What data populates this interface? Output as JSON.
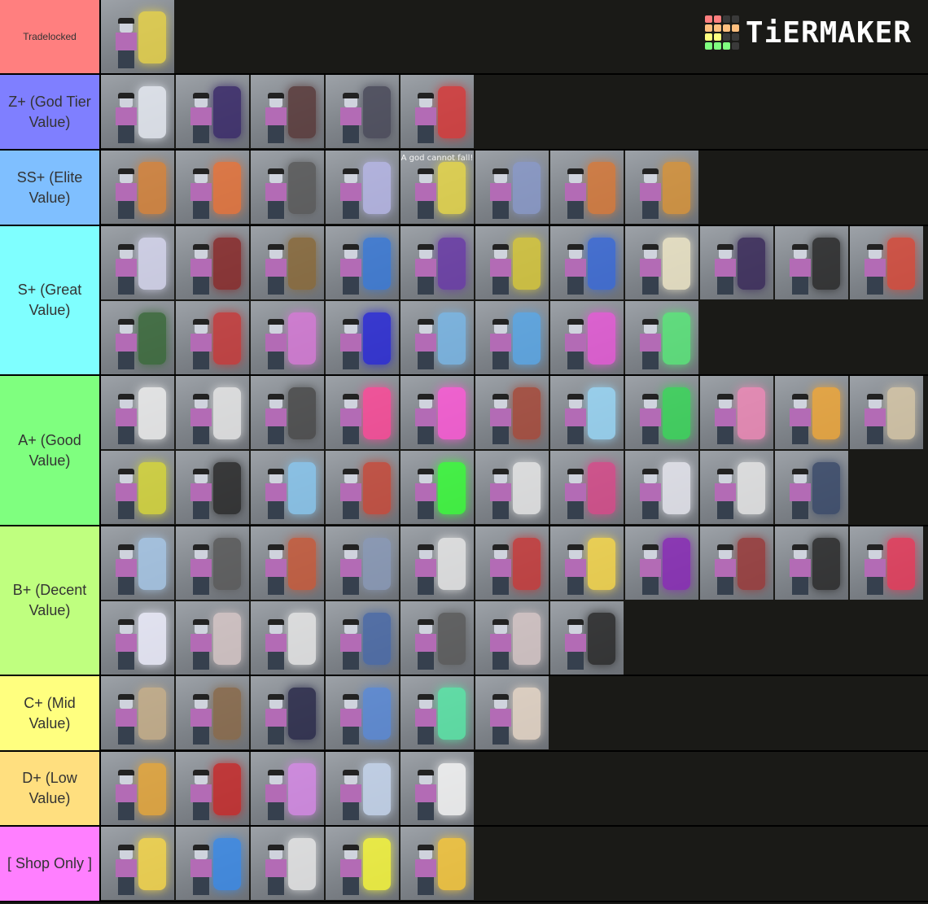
{
  "logo": {
    "text": "TiERMAKER",
    "grid_colors": [
      "#ff7f7f",
      "#ff7f7f",
      "#3a3a3a",
      "#3a3a3a",
      "#ffbf7f",
      "#ffbf7f",
      "#ffbf7f",
      "#ffbf7f",
      "#ffff7f",
      "#ffff7f",
      "#3a3a3a",
      "#3a3a3a",
      "#7fff7f",
      "#7fff7f",
      "#7fff7f",
      "#3a3a3a"
    ]
  },
  "tiers": [
    {
      "label": "Tradelocked",
      "color": "#ff7f7f",
      "small": true,
      "height": 92,
      "items": [
        {
          "stand": "#e8d34a"
        }
      ]
    },
    {
      "label": "Z+ (God Tier Value)",
      "color": "#7f7fff",
      "height": 93,
      "items": [
        {
          "stand": "#e8ecf4"
        },
        {
          "stand": "#3a2a6a"
        },
        {
          "stand": "#5a3a3a"
        },
        {
          "stand": "#4a4a5a"
        },
        {
          "stand": "#d83a3a"
        }
      ]
    },
    {
      "label": "SS+ (Elite Value)",
      "color": "#7fbfff",
      "height": 93,
      "items": [
        {
          "stand": "#d8843a"
        },
        {
          "stand": "#e8743a"
        },
        {
          "stand": "#5a5a5a"
        },
        {
          "stand": "#b8b8e8"
        },
        {
          "stand": "#e8d84a",
          "caption": "A god cannot fall!"
        },
        {
          "stand": "#8a9aca"
        },
        {
          "stand": "#d87a3a"
        },
        {
          "stand": "#d8943a"
        }
      ]
    },
    {
      "label": "S+ (Great Value)",
      "color": "#7fffff",
      "height": 184,
      "items": [
        {
          "stand": "#d8d8f0"
        },
        {
          "stand": "#8a2a2a"
        },
        {
          "stand": "#8a6a3a"
        },
        {
          "stand": "#3a7ad8"
        },
        {
          "stand": "#6a3aa8"
        },
        {
          "stand": "#d8c83a"
        },
        {
          "stand": "#3a6ad8"
        },
        {
          "stand": "#f0e8c8"
        },
        {
          "stand": "#3a2a5a"
        },
        {
          "stand": "#2a2a2a"
        },
        {
          "stand": "#d84a3a"
        },
        {
          "stand": "#3a6a3a"
        },
        {
          "stand": "#c83a3a"
        },
        {
          "stand": "#d87ad8"
        },
        {
          "stand": "#2a2ad8"
        },
        {
          "stand": "#7ab8e8"
        },
        {
          "stand": "#5aa8e8"
        },
        {
          "stand": "#e85ad8"
        },
        {
          "stand": "#5ae87a"
        }
      ]
    },
    {
      "label": "A+ (Good Value)",
      "color": "#7fff7f",
      "height": 185,
      "items": [
        {
          "stand": "#f0f0f0"
        },
        {
          "stand": "#e8e8e8"
        },
        {
          "stand": "#4a4a4a"
        },
        {
          "stand": "#ff4a9a"
        },
        {
          "stand": "#ff5ad8"
        },
        {
          "stand": "#a84a3a"
        },
        {
          "stand": "#9ad8f8"
        },
        {
          "stand": "#3ad85a"
        },
        {
          "stand": "#f08ab8"
        },
        {
          "stand": "#f0a83a"
        },
        {
          "stand": "#d8c8a8"
        },
        {
          "stand": "#d8d83a"
        },
        {
          "stand": "#2a2a2a"
        },
        {
          "stand": "#8ac8f0"
        },
        {
          "stand": "#c84a3a"
        },
        {
          "stand": "#3aff3a"
        },
        {
          "stand": "#e8e8e8"
        },
        {
          "stand": "#d84a8a"
        },
        {
          "stand": "#e8e8f0"
        },
        {
          "stand": "#e8e8e8"
        },
        {
          "stand": "#3a4a6a"
        }
      ]
    },
    {
      "label": "B+ (Decent Value)",
      "color": "#bfff7f",
      "height": 184,
      "items": [
        {
          "stand": "#a8c8e8"
        },
        {
          "stand": "#5a5a5a"
        },
        {
          "stand": "#c85a3a"
        },
        {
          "stand": "#8a9ab8"
        },
        {
          "stand": "#e8e8e8"
        },
        {
          "stand": "#c83a3a"
        },
        {
          "stand": "#f8d84a"
        },
        {
          "stand": "#8a2ab8"
        },
        {
          "stand": "#9a3a3a"
        },
        {
          "stand": "#2a2a2a"
        },
        {
          "stand": "#e83a5a"
        },
        {
          "stand": "#f0f0ff"
        },
        {
          "stand": "#d8c8c8"
        },
        {
          "stand": "#e8e8e8"
        },
        {
          "stand": "#4a6aa8"
        },
        {
          "stand": "#5a5a5a"
        },
        {
          "stand": "#d8c8c8"
        },
        {
          "stand": "#2a2a2a"
        }
      ]
    },
    {
      "label": "C+ (Mid Value)",
      "color": "#ffff7f",
      "height": 93,
      "items": [
        {
          "stand": "#c8b08a"
        },
        {
          "stand": "#8a6a4a"
        },
        {
          "stand": "#2a2a4a"
        },
        {
          "stand": "#5a8ad8"
        },
        {
          "stand": "#5ae8a8"
        },
        {
          "stand": "#e8d8c8"
        }
      ]
    },
    {
      "label": "D+ (Low Value)",
      "color": "#ffdf7f",
      "height": 92,
      "items": [
        {
          "stand": "#e8a83a"
        },
        {
          "stand": "#c82a2a"
        },
        {
          "stand": "#d88ae8"
        },
        {
          "stand": "#c8d8f0"
        },
        {
          "stand": "#f8f8f8"
        }
      ]
    },
    {
      "label": "[ Shop Only ]",
      "color": "#ff7fff",
      "height": 93,
      "items": [
        {
          "stand": "#f8d84a"
        },
        {
          "stand": "#3a8ae8"
        },
        {
          "stand": "#e8e8e8"
        },
        {
          "stand": "#f8f83a"
        },
        {
          "stand": "#f8c83a"
        }
      ]
    }
  ]
}
